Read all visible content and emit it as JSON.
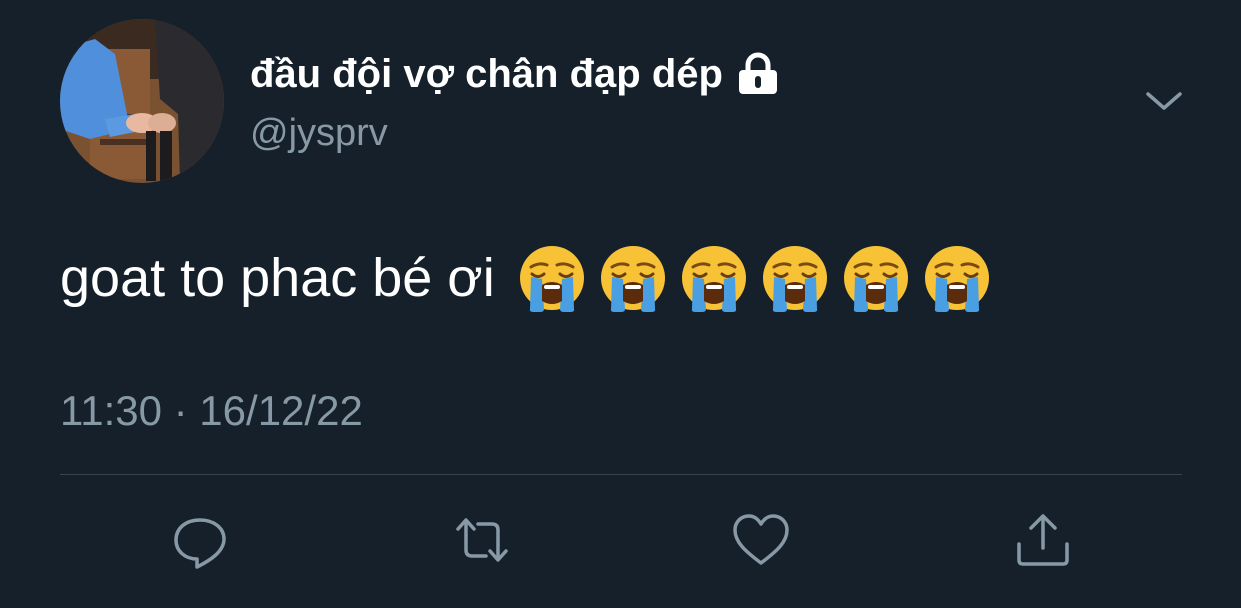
{
  "tweet": {
    "display_name": "đầu đội vợ chân đạp dép",
    "handle": "@jysprv",
    "text": "goat to phac bé ơi",
    "emojis": [
      "loudly-crying-face",
      "loudly-crying-face",
      "loudly-crying-face",
      "loudly-crying-face",
      "loudly-crying-face",
      "loudly-crying-face"
    ],
    "timestamp": "11:30 · 16/12/22",
    "protected_icon": "lock-icon",
    "menu_icon": "chevron-down-icon"
  },
  "actions": [
    {
      "name": "reply",
      "icon": "reply-icon"
    },
    {
      "name": "retweet",
      "icon": "retweet-icon"
    },
    {
      "name": "like",
      "icon": "heart-icon"
    },
    {
      "name": "share",
      "icon": "share-icon"
    }
  ],
  "colors": {
    "background": "#15202b",
    "primary_text": "#ffffff",
    "secondary_text": "#8899a6",
    "divider": "#38444d"
  }
}
